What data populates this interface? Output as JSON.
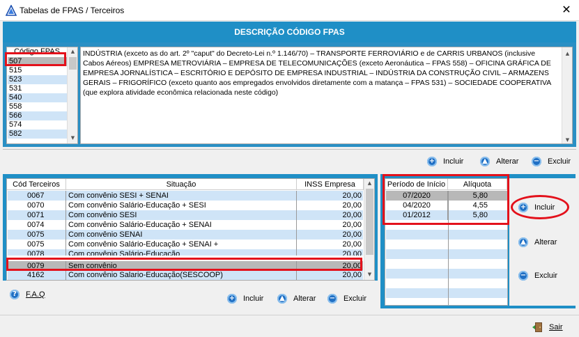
{
  "window": {
    "title": "Tabelas de FPAS / Terceiros",
    "close_glyph": "✕"
  },
  "banner": "DESCRIÇÃO CÓDIGO FPAS",
  "fpas": {
    "header": "Código FPAS",
    "codes": [
      "507",
      "515",
      "523",
      "531",
      "540",
      "558",
      "566",
      "574",
      "582"
    ],
    "selected": "507",
    "description": "INDÚSTRIA (exceto as do art. 2º \"caput\" do Decreto-Lei n.º 1.146/70) – TRANSPORTE FERROVIÁRIO e de CARRIS URBANOS (inclusive Cabos Aéreos) EMPRESA METROVIÁRIA – EMPRESA DE TELECOMUNICAÇÕES (exceto Aeronáutica – FPAS 558) – OFICINA GRÁFICA DE EMPRESA JORNALÍSTICA – ESCRITÓRIO E DEPÓSITO DE EMPRESA INDUSTRIAL – INDÚSTRIA DA CONSTRUÇÃO CIVIL – ARMAZENS GERAIS – FRIGORÍFICO (exceto quanto aos empregados envolvidos diretamente com a matança – FPAS 531) – SOCIEDADE COOPERATIVA (que explora atividade econômica relacionada neste código)"
  },
  "fpas_actions": {
    "include": "Incluir",
    "alter": "Alterar",
    "delete": "Excluir"
  },
  "terceiros": {
    "headers": {
      "code": "Cód Terceiros",
      "situation": "Situação",
      "inss": "INSS Empresa"
    },
    "rows": [
      {
        "code": "0067",
        "situation": "Com convênio SESI + SENAI",
        "inss": "20,00"
      },
      {
        "code": "0070",
        "situation": "Com convênio Salário-Educação + SESI",
        "inss": "20,00"
      },
      {
        "code": "0071",
        "situation": "Com convênio SESI",
        "inss": "20,00"
      },
      {
        "code": "0074",
        "situation": "Com convênio Salário-Educação + SENAI",
        "inss": "20,00"
      },
      {
        "code": "0075",
        "situation": "Com convênio SENAI",
        "inss": "20,00"
      },
      {
        "code": "0075",
        "situation": "Com convênio Salário-Educação + SENAI +",
        "inss": "20,00"
      },
      {
        "code": "0078",
        "situation": "Com convênio Salário-Educação",
        "inss": "20,00"
      },
      {
        "code": "0079",
        "situation": "Sem convênio",
        "inss": "20,00"
      },
      {
        "code": "4162",
        "situation": "Com convênio Salario-Educação(SESCOOP)",
        "inss": "20,00"
      }
    ],
    "selected_code": "0079"
  },
  "faq": {
    "icon": "?",
    "label": "F.A.Q"
  },
  "terceiros_actions": {
    "include": "Incluir",
    "alter": "Alterar",
    "delete": "Excluir"
  },
  "periods": {
    "headers": {
      "start": "Período de Início",
      "rate": "Alíquota"
    },
    "rows": [
      {
        "start": "07/2020",
        "rate": "5,80"
      },
      {
        "start": "04/2020",
        "rate": "4,55"
      },
      {
        "start": "01/2012",
        "rate": "5,80"
      }
    ]
  },
  "period_actions": {
    "include": "Incluir",
    "alter": "Alterar",
    "delete": "Excluir"
  },
  "footer": {
    "exit": "Sair"
  },
  "icons": {
    "app": "triangle-app-icon",
    "add": "plus-circle-icon",
    "edit": "triangle-up-circle-icon",
    "remove": "minus-circle-icon",
    "help": "help-circle-icon",
    "exit": "door-exit-icon"
  },
  "colors": {
    "banner": "#1f8fc6",
    "highlight": "#e3111b",
    "row_alt": "#cfe4f7",
    "row_selected": "#b8b8b8"
  }
}
